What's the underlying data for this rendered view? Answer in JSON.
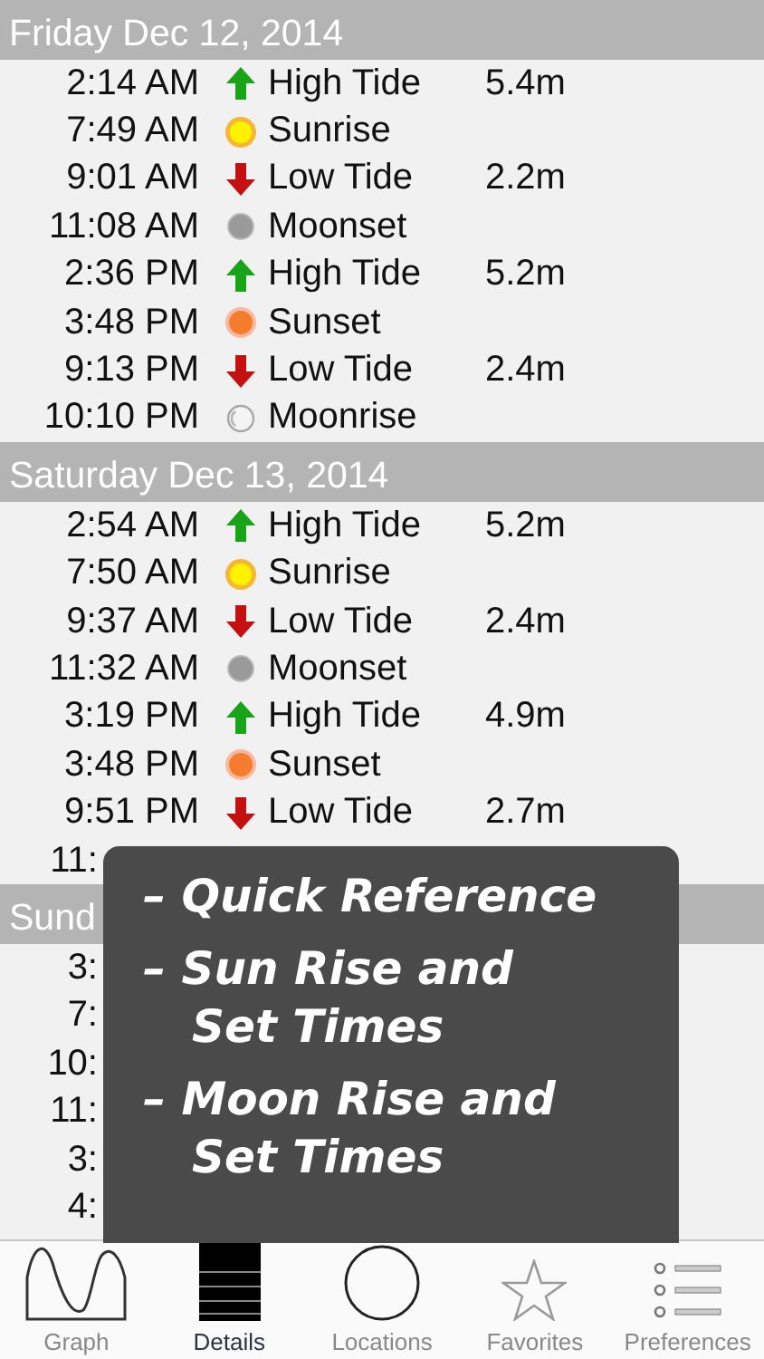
{
  "days": [
    {
      "heading": "Friday Dec 12, 2014",
      "events": [
        {
          "time": "2:14 AM",
          "kind": "high",
          "label": "High Tide",
          "value": "5.4m"
        },
        {
          "time": "7:49 AM",
          "kind": "sunrise",
          "label": "Sunrise"
        },
        {
          "time": "9:01 AM",
          "kind": "low",
          "label": "Low Tide",
          "value": "2.2m"
        },
        {
          "time": "11:08 AM",
          "kind": "moonset",
          "label": "Moonset"
        },
        {
          "time": "2:36 PM",
          "kind": "high",
          "label": "High Tide",
          "value": "5.2m"
        },
        {
          "time": "3:48 PM",
          "kind": "sunset",
          "label": "Sunset"
        },
        {
          "time": "9:13 PM",
          "kind": "low",
          "label": "Low Tide",
          "value": "2.4m"
        },
        {
          "time": "10:10 PM",
          "kind": "moonrise",
          "label": "Moonrise"
        }
      ]
    },
    {
      "heading": "Saturday Dec 13, 2014",
      "events": [
        {
          "time": "2:54 AM",
          "kind": "high",
          "label": "High Tide",
          "value": "5.2m"
        },
        {
          "time": "7:50 AM",
          "kind": "sunrise",
          "label": "Sunrise"
        },
        {
          "time": "9:37 AM",
          "kind": "low",
          "label": "Low Tide",
          "value": "2.4m"
        },
        {
          "time": "11:32 AM",
          "kind": "moonset",
          "label": "Moonset"
        },
        {
          "time": "3:19 PM",
          "kind": "high",
          "label": "High Tide",
          "value": "4.9m"
        },
        {
          "time": "3:48 PM",
          "kind": "sunset",
          "label": "Sunset"
        },
        {
          "time": "9:51 PM",
          "kind": "low",
          "label": "Low Tide",
          "value": "2.7m"
        },
        {
          "time": "11:"
        }
      ]
    },
    {
      "heading": "Sund",
      "events": [
        {
          "time": "3:"
        },
        {
          "time": "7:"
        },
        {
          "time": "10:"
        },
        {
          "time": "11:"
        },
        {
          "time": "3:"
        },
        {
          "time": "4:"
        }
      ]
    }
  ],
  "overlay": {
    "items": [
      {
        "lines": [
          "– Quick Reference"
        ]
      },
      {
        "lines": [
          "– Sun Rise and",
          "Set Times"
        ]
      },
      {
        "lines": [
          "– Moon Rise and",
          "Set Times"
        ]
      }
    ]
  },
  "tabs": [
    {
      "label": "Graph",
      "kind": "graph",
      "selected": false
    },
    {
      "label": "Details",
      "kind": "details",
      "selected": true
    },
    {
      "label": "Locations",
      "kind": "locations",
      "selected": false
    },
    {
      "label": "Favorites",
      "kind": "favorites",
      "selected": false
    },
    {
      "label": "Preferences",
      "kind": "preferences",
      "selected": false
    }
  ]
}
